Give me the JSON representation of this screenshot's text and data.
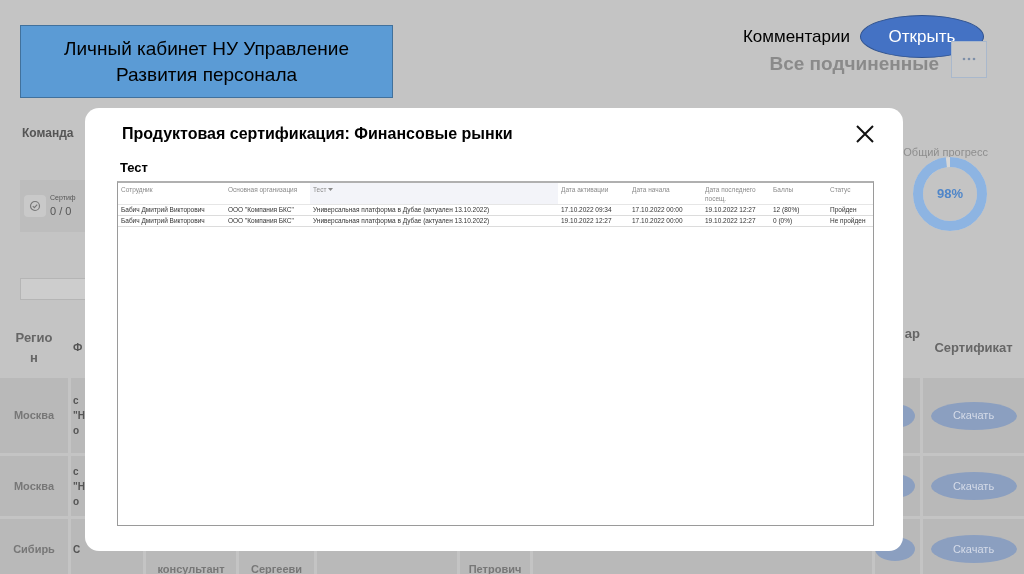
{
  "banner": {
    "title": "Личный кабинет НУ Управление Развития персонала"
  },
  "comments": {
    "label": "Комментарии",
    "button": "Открыть"
  },
  "background": {
    "team_tab": "Команда",
    "scope_label": "Все подчиненные",
    "stat_card": {
      "caption": "Сертиф",
      "value": "0 / 0"
    },
    "progress": {
      "label": "Общий прогресс",
      "value": "98%",
      "level": 0.98
    },
    "table": {
      "columns": [
        {
          "label": "Регион"
        },
        {
          "label": "Ф"
        },
        {
          "label": "ар"
        },
        {
          "label": "Сертификат"
        }
      ],
      "rows": [
        {
          "region": "Москва",
          "column_2": [
            "с",
            "\"Н",
            "о"
          ],
          "button": "Скачать"
        },
        {
          "region": "Москва",
          "column_2": [
            "с",
            "\"Н",
            "о"
          ],
          "button": "Скачать"
        },
        {
          "region": "Сибирь",
          "column_2": [
            "С"
          ],
          "bottom_texts": [
            "консультант",
            "Сергееви",
            "Петрович"
          ],
          "button": "Скачать"
        }
      ]
    }
  },
  "dialog": {
    "title": "Продуктовая сертификация: Финансовые рынки",
    "section": "Тест",
    "table": {
      "columns": [
        {
          "label": "Сотрудник",
          "sorted": false
        },
        {
          "label": "Основная организация",
          "sorted": false
        },
        {
          "label": "Тест",
          "sorted": true
        },
        {
          "label": "Дата активации",
          "sorted": false
        },
        {
          "label": "Дата начала",
          "sorted": false
        },
        {
          "label": "Дата последнего посещ.",
          "sorted": false
        },
        {
          "label": "Баллы",
          "sorted": false
        },
        {
          "label": "Статус",
          "sorted": false
        }
      ],
      "rows": [
        [
          "Бабич Дмитрий Викторович",
          "ООО \"Компания БКС\"",
          "Универсальная платформа в Дубае (актуален 13.10.2022)",
          "17.10.2022 09:34",
          "17.10.2022 00:00",
          "19.10.2022 12:27",
          "12 (80%)",
          "Пройден"
        ],
        [
          "Бабич Дмитрий Викторович",
          "ООО \"Компания БКС\"",
          "Универсальная платформа в Дубае (актуален 13.10.2022)",
          "19.10.2022 12:27",
          "17.10.2022 00:00",
          "19.10.2022 12:27",
          "0 (0%)",
          "Не пройден"
        ]
      ]
    }
  }
}
